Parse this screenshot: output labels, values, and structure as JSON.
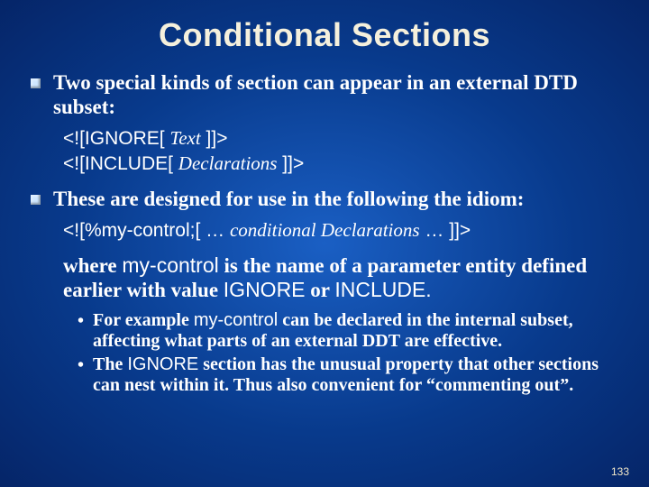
{
  "title": "Conditional Sections",
  "bullet1": "Two special kinds of section can appear in an external DTD subset:",
  "code1_a": "<![IGNORE[ ",
  "code1_b": "Text",
  "code1_c": " ]]>",
  "code2_a": "<![INCLUDE[ ",
  "code2_b": "Declarations",
  "code2_c": " ]]>",
  "bullet2": "These are designed for use in the following the idiom:",
  "code3_a": "<![",
  "code3_b": "%my-control;",
  "code3_c": "[ … ",
  "code3_d": "conditional Declarations",
  "code3_e": " … ]]>",
  "para_a": "where ",
  "para_b": "my-control",
  "para_c": " is the name of a parameter entity defined earlier with value ",
  "para_d": "IGNORE",
  "para_e": " or ",
  "para_f": "INCLUDE.",
  "sub1_a": "For example ",
  "sub1_b": "my-control",
  "sub1_c": " can be declared in the internal subset, affecting what parts of an external DDT are effective.",
  "sub2_a": "The ",
  "sub2_b": "IGNORE",
  "sub2_c": " section has the unusual property that other sections can nest within it.  Thus also convenient for “commenting out”.",
  "pagenum": "133"
}
